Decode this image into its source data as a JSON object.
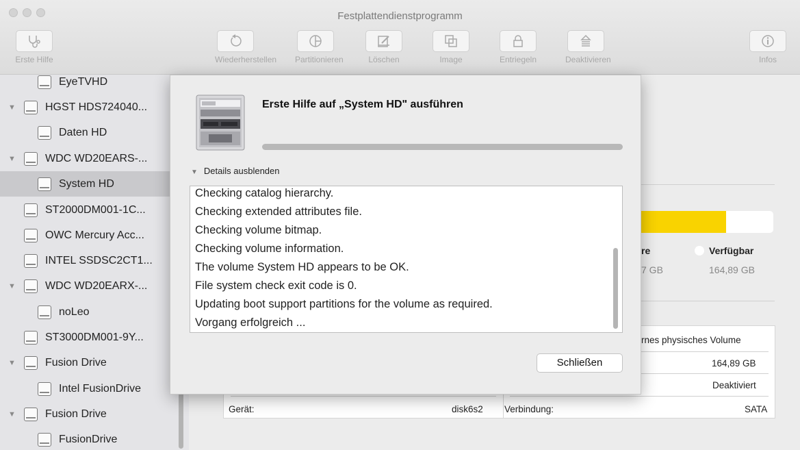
{
  "window": {
    "title": "Festplattendienstprogramm"
  },
  "toolbar": {
    "first_aid": "Erste Hilfe",
    "restore": "Wiederherstellen",
    "partition": "Partitionieren",
    "erase": "Löschen",
    "image": "Image",
    "unlock": "Entriegeln",
    "unmount": "Deaktivieren",
    "info": "Infos"
  },
  "sidebar": {
    "items": [
      {
        "label": "EyeTVHD"
      },
      {
        "label": "HGST HDS724040..."
      },
      {
        "label": "Daten HD"
      },
      {
        "label": "WDC WD20EARS-..."
      },
      {
        "label": "System HD"
      },
      {
        "label": "ST2000DM001-1C..."
      },
      {
        "label": "OWC Mercury Acc..."
      },
      {
        "label": "INTEL SSDSC2CT1..."
      },
      {
        "label": "WDC WD20EARX-..."
      },
      {
        "label": "noLeo"
      },
      {
        "label": "ST3000DM001-9Y..."
      },
      {
        "label": "Fusion Drive"
      },
      {
        "label": "Intel FusionDrive"
      },
      {
        "label": "Fusion Drive"
      },
      {
        "label": "FusionDrive"
      }
    ]
  },
  "dialog": {
    "title": "Erste Hilfe auf „System HD\" ausführen",
    "details_toggle": "Details ausblenden",
    "log": [
      "Checking catalog hierarchy.",
      "Checking extended attributes file.",
      "Checking volume bitmap.",
      "Checking volume information.",
      "The volume System HD appears to be OK.",
      "File system check exit code is 0.",
      "Updating boot support partitions for the volume as required.",
      "Vorgang erfolgreich ..."
    ],
    "close_button": "Schließen"
  },
  "capacity": {
    "used_label_partial": "re",
    "used_value_partial": "7 GB",
    "available_label": "Verfügbar",
    "available_value": "164,89 GB",
    "fill_fraction": 0.65,
    "fill_color": "#f9d300"
  },
  "info": {
    "type_partial": "rnes physisches Volume",
    "capacity_value": "164,89 GB",
    "owners_value": "Deaktiviert",
    "device_label": "Gerät:",
    "device_value": "disk6s2",
    "connection_label": "Verbindung:",
    "connection_value": "SATA"
  }
}
